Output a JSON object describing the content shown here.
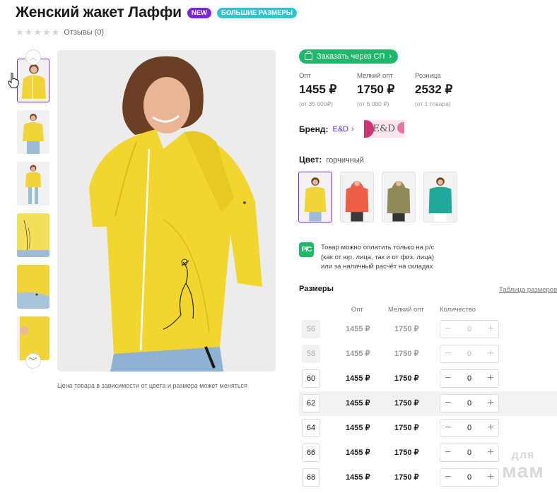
{
  "product": {
    "title": "Женский жакет Лаффи",
    "badges": {
      "new": "NEW",
      "sizes": "БОЛЬШИЕ РАЗМЕРЫ"
    },
    "rating_stars": 0,
    "reviews": "Отзывы (0)"
  },
  "gallery": {
    "thumb_count": 6,
    "photo_note": "Цена товара в зависимости от цвета и размера может меняться"
  },
  "order_button": {
    "label": "Заказать через СП"
  },
  "prices": [
    {
      "label": "Опт",
      "value": "1455 ₽",
      "note": "(от 35 000₽)"
    },
    {
      "label": "Мелкий опт",
      "value": "1750 ₽",
      "note": "(от 5 000 ₽)"
    },
    {
      "label": "Розница",
      "value": "2532 ₽",
      "note": "(от 1 товара)"
    }
  ],
  "brand": {
    "label": "Бренд:",
    "name": "E&D",
    "logo_text": "E&D"
  },
  "color": {
    "label": "Цвет:",
    "value": "горчичный",
    "swatches": [
      {
        "name": "горчичный",
        "hex": "#f0d43a"
      },
      {
        "name": "коралловый",
        "hex": "#ee5d45"
      },
      {
        "name": "хаки",
        "hex": "#8f8a59"
      },
      {
        "name": "бирюзовый",
        "hex": "#1ea99a"
      }
    ]
  },
  "payment": {
    "icon": "Р/С",
    "lines": [
      "Товар можно оплатить только на р/с",
      "(как от юр. лица, так и от физ. лица)",
      "или за наличный расчёт на складах"
    ]
  },
  "sizes": {
    "title": "Размеры",
    "table_link": "Таблица размеров",
    "columns": {
      "opt": "Опт",
      "small": "Мелкий опт",
      "qty": "Количество"
    },
    "rows": [
      {
        "size": "56",
        "opt": "1455 ₽",
        "small": "1750 ₽",
        "qty": "0",
        "disabled": true
      },
      {
        "size": "58",
        "opt": "1455 ₽",
        "small": "1750 ₽",
        "qty": "0",
        "disabled": true
      },
      {
        "size": "60",
        "opt": "1455 ₽",
        "small": "1750 ₽",
        "qty": "0",
        "disabled": false
      },
      {
        "size": "62",
        "opt": "1455 ₽",
        "small": "1750 ₽",
        "qty": "0",
        "disabled": false,
        "highlight": true
      },
      {
        "size": "64",
        "opt": "1455 ₽",
        "small": "1750 ₽",
        "qty": "0",
        "disabled": false
      },
      {
        "size": "66",
        "opt": "1455 ₽",
        "small": "1750 ₽",
        "qty": "0",
        "disabled": false
      },
      {
        "size": "68",
        "opt": "1455 ₽",
        "small": "1750 ₽",
        "qty": "0",
        "disabled": false
      }
    ]
  },
  "watermark": {
    "line1": "для",
    "line2": "мам"
  },
  "colors": {
    "accent": "#7a28d6",
    "green": "#1fb868",
    "jacket": "#f0d43a",
    "badge_cyan": "#35c3d4"
  }
}
